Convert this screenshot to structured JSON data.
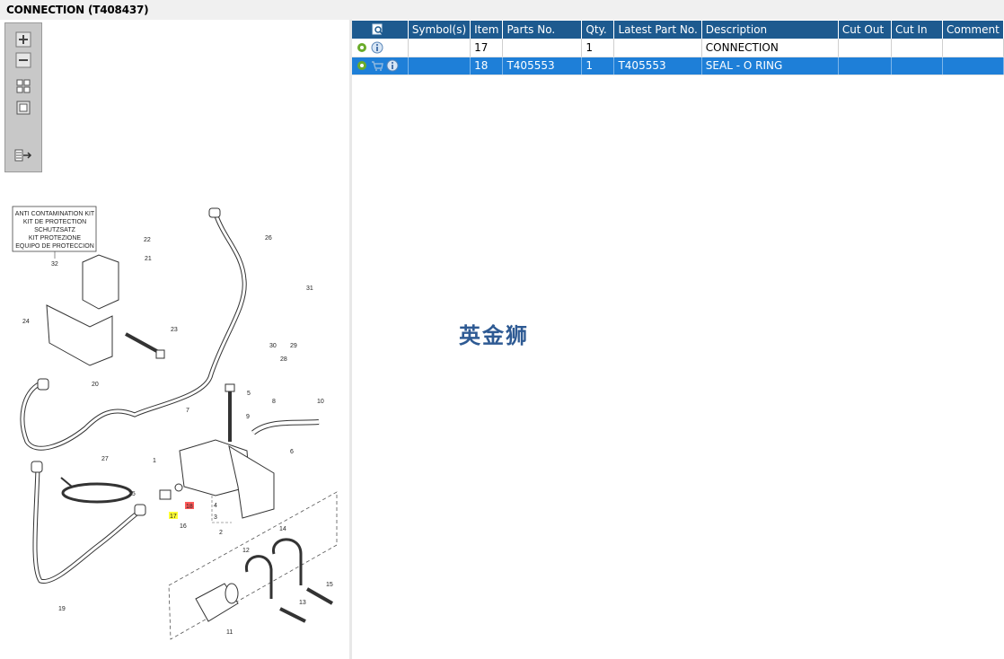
{
  "window": {
    "title": "CONNECTION (T408437)"
  },
  "toolbar": {
    "zoom_in_icon": "zoom-in-icon",
    "zoom_out_icon": "zoom-out-icon",
    "fit_icon": "fit-window-icon",
    "actual_size_icon": "actual-size-icon",
    "export_icon": "export-list-icon"
  },
  "diagram": {
    "kit_box_lines": [
      "ANTI CONTAMINATION KIT",
      "KIT DE PROTECTION",
      "SCHUTZSATZ",
      "KIT PROTEZIONE",
      "EQUIPO DE PROTECCION"
    ],
    "callouts": [
      "1",
      "2",
      "3",
      "4",
      "5",
      "6",
      "7",
      "8",
      "9",
      "10",
      "11",
      "12",
      "13",
      "14",
      "15",
      "16",
      "17",
      "18",
      "19",
      "20",
      "21",
      "22",
      "23",
      "24",
      "25",
      "26",
      "27",
      "28",
      "29",
      "30",
      "31",
      "32"
    ],
    "highlight_yellow": "17",
    "highlight_red": "18"
  },
  "grid": {
    "columns": [
      "Symbol(s)",
      "Item",
      "Parts No.",
      "Qty.",
      "Latest Part No.",
      "Description",
      "Cut Out",
      "Cut In",
      "Comment"
    ],
    "rows": [
      {
        "item": "17",
        "parts_no": "",
        "qty": "1",
        "latest_part_no": "",
        "description": "CONNECTION",
        "cut_out": "",
        "cut_in": "",
        "comment": "",
        "selected": false
      },
      {
        "item": "18",
        "parts_no": "T405553",
        "qty": "1",
        "latest_part_no": "T405553",
        "description": "SEAL - O RING",
        "cut_out": "",
        "cut_in": "",
        "comment": "",
        "selected": true
      }
    ]
  },
  "watermark": {
    "text": "英金狮"
  },
  "colors": {
    "header_bg": "#1d5a8f",
    "selected_row": "#1e7fd8",
    "highlight_yellow": "#ffff33",
    "highlight_red": "#ff5a5a"
  }
}
